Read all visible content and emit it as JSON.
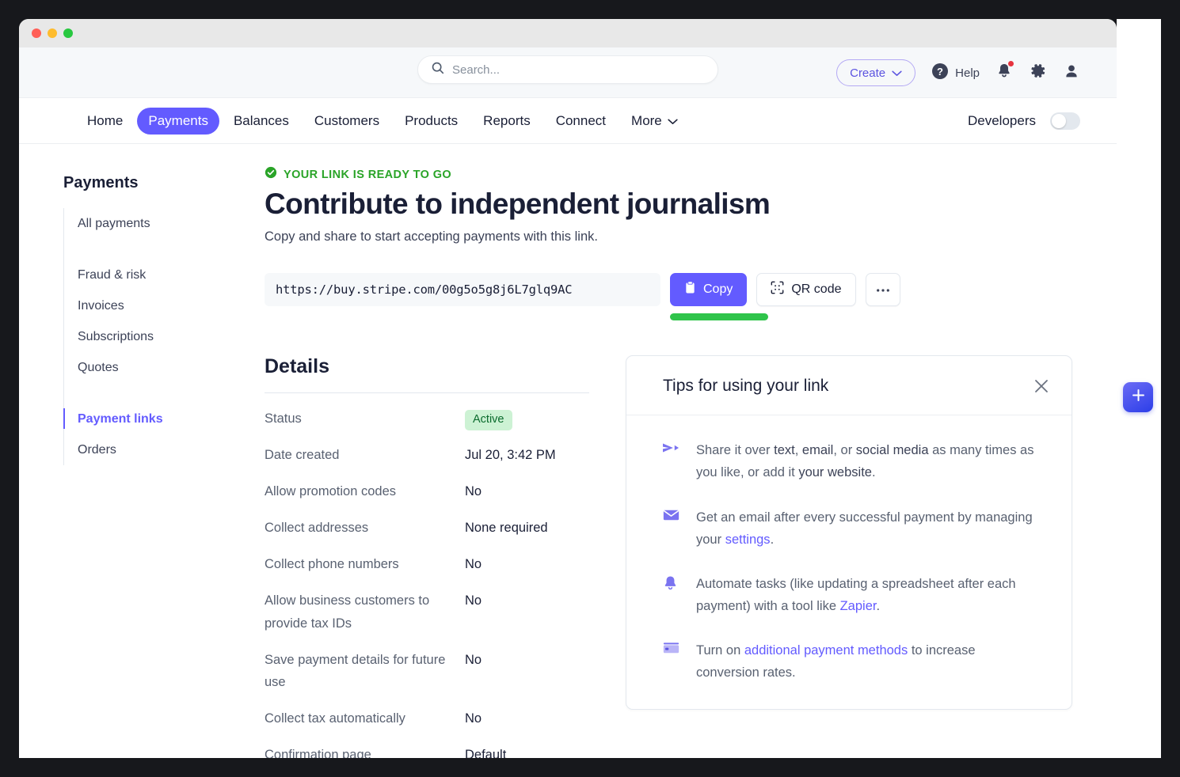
{
  "window": {
    "traffic_lights": [
      "close",
      "minimize",
      "maximize"
    ]
  },
  "header": {
    "search_placeholder": "Search...",
    "create_label": "Create",
    "help_label": "Help",
    "icons": [
      "question-mark-icon",
      "bell-icon",
      "gear-icon",
      "user-icon"
    ]
  },
  "nav": {
    "items": [
      {
        "label": "Home",
        "active": false
      },
      {
        "label": "Payments",
        "active": true
      },
      {
        "label": "Balances",
        "active": false
      },
      {
        "label": "Customers",
        "active": false
      },
      {
        "label": "Products",
        "active": false
      },
      {
        "label": "Reports",
        "active": false
      },
      {
        "label": "Connect",
        "active": false
      },
      {
        "label": "More",
        "active": false
      }
    ],
    "developers_label": "Developers",
    "developers_toggle": "off"
  },
  "sidebar": {
    "title": "Payments",
    "items": [
      {
        "label": "All payments",
        "active": false
      },
      {
        "label": "Fraud & risk",
        "active": false
      },
      {
        "label": "Invoices",
        "active": false
      },
      {
        "label": "Subscriptions",
        "active": false
      },
      {
        "label": "Quotes",
        "active": false
      },
      {
        "label": "Payment links",
        "active": true
      },
      {
        "label": "Orders",
        "active": false
      }
    ]
  },
  "main": {
    "status_banner": "YOUR LINK IS READY TO GO",
    "title": "Contribute to independent journalism",
    "subtitle": "Copy and share to start accepting payments with this link.",
    "url": "https://buy.stripe.com/00g5o5g8j6L7glq9AC",
    "copy_label": "Copy",
    "qr_label": "QR code",
    "more_label": "•••",
    "highlight_color": "#2fc44b"
  },
  "details": {
    "title": "Details",
    "rows": [
      {
        "label": "Status",
        "value": "Active",
        "type": "badge"
      },
      {
        "label": "Date created",
        "value": "Jul 20, 3:42 PM",
        "type": "text"
      },
      {
        "label": "Allow promotion codes",
        "value": "No",
        "type": "text"
      },
      {
        "label": "Collect addresses",
        "value": "None required",
        "type": "text"
      },
      {
        "label": "Collect phone numbers",
        "value": "No",
        "type": "text"
      },
      {
        "label": "Allow business customers to provide tax IDs",
        "value": "No",
        "type": "text"
      },
      {
        "label": "Save payment details for future use",
        "value": "No",
        "type": "text"
      },
      {
        "label": "Collect tax automatically",
        "value": "No",
        "type": "text"
      },
      {
        "label": "Confirmation page",
        "value": "Default",
        "type": "text"
      }
    ]
  },
  "tips": {
    "title": "Tips for using your link",
    "close_icon": "close-icon",
    "items": [
      {
        "icon": "send-arrow-icon",
        "parts": [
          {
            "t": "Share it over ",
            "s": "plain"
          },
          {
            "t": "text",
            "s": "em"
          },
          {
            "t": ", ",
            "s": "plain"
          },
          {
            "t": "email",
            "s": "em"
          },
          {
            "t": ", or ",
            "s": "plain"
          },
          {
            "t": "social media",
            "s": "em"
          },
          {
            "t": " as many times as you like, or add it ",
            "s": "plain"
          },
          {
            "t": "your website",
            "s": "em"
          },
          {
            "t": ".",
            "s": "plain"
          }
        ]
      },
      {
        "icon": "envelope-icon",
        "parts": [
          {
            "t": "Get an email after every successful payment by managing your ",
            "s": "plain"
          },
          {
            "t": "settings",
            "s": "link"
          },
          {
            "t": ".",
            "s": "plain"
          }
        ]
      },
      {
        "icon": "bell-icon",
        "parts": [
          {
            "t": "Automate tasks (like updating a spreadsheet after each payment) with a tool like ",
            "s": "plain"
          },
          {
            "t": "Zapier",
            "s": "link"
          },
          {
            "t": ".",
            "s": "plain"
          }
        ]
      },
      {
        "icon": "credit-card-icon",
        "parts": [
          {
            "t": "Turn on ",
            "s": "plain"
          },
          {
            "t": "additional payment methods",
            "s": "link"
          },
          {
            "t": " to increase conversion rates.",
            "s": "plain"
          }
        ]
      }
    ]
  },
  "rail": {
    "fab_label": "+",
    "fab_icon": "plus-icon"
  },
  "colors": {
    "brand_purple": "#635bff",
    "success_green": "#2aa428",
    "badge_bg": "#cdf2d4",
    "badge_text": "#0b6b2d",
    "highlight_green": "#2fc44b",
    "notification_red": "#e6333e"
  }
}
